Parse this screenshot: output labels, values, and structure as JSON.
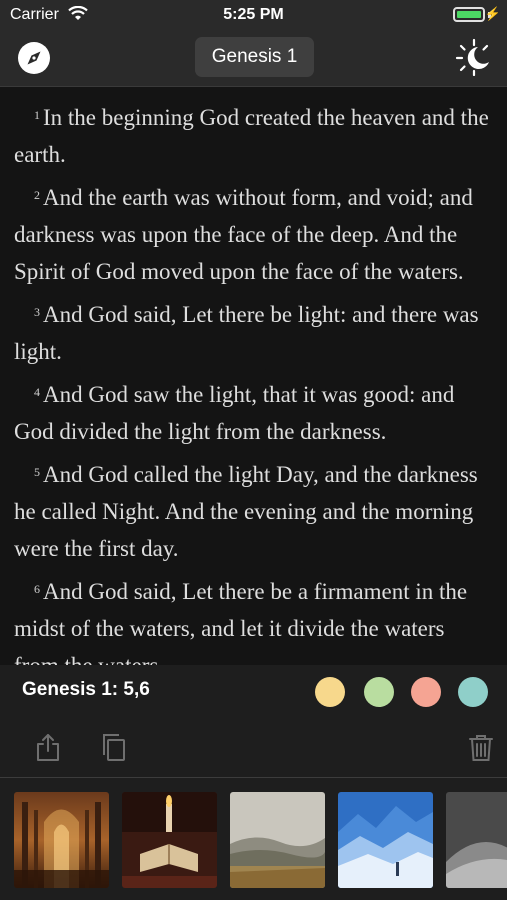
{
  "status_bar": {
    "carrier": "Carrier",
    "time": "5:25 PM",
    "battery_level": 1.0
  },
  "nav": {
    "title": "Genesis 1",
    "left_icon": "compass-icon",
    "right_icon": "sun-moon-icon"
  },
  "verses": [
    {
      "num": "1",
      "text": "In the beginning God created the heaven and the earth."
    },
    {
      "num": "2",
      "text": "And the earth was without form, and void; and darkness was upon the face of the deep. And the Spirit of God moved upon the face of the waters."
    },
    {
      "num": "3",
      "text": "And God said, Let there be light: and there was light."
    },
    {
      "num": "4",
      "text": "And God saw the light, that it was good: and God divided the light from the darkness."
    },
    {
      "num": "5",
      "text": "And God called the light Day, and the darkness he called Night. And the evening and the morning were the first day."
    },
    {
      "num": "6",
      "text": "And God said, Let there be a firmament in the midst of the waters, and let it divide the waters from the waters."
    }
  ],
  "selection": {
    "reference": "Genesis 1: 5,6",
    "highlight_colors": [
      "#f7d88c",
      "#b9dda0",
      "#f5a493",
      "#8fcfc9"
    ]
  },
  "toolbar": {
    "share_icon": "share-icon",
    "copy_icon": "copy-icon",
    "trash_icon": "trash-icon"
  },
  "backgrounds": [
    "cathedral-interior",
    "bible-candle",
    "misty-landscape",
    "snowy-mountain-mist",
    "abstract-silver"
  ]
}
